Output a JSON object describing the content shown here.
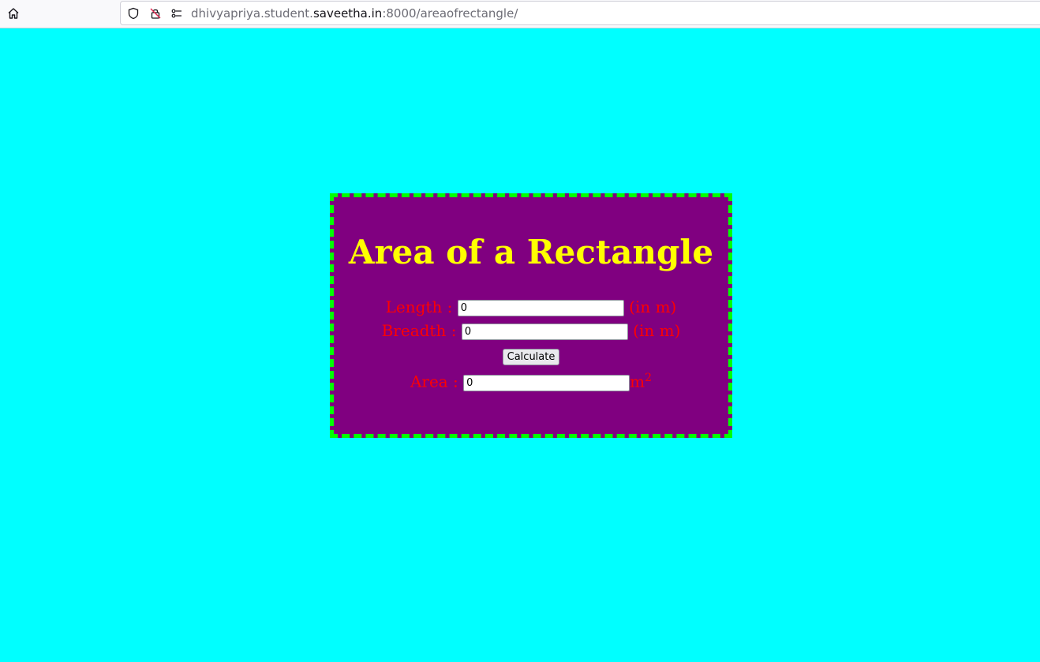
{
  "browser": {
    "url_prefix": "dhivyapriya.student.",
    "url_domain": "saveetha.in",
    "url_suffix": ":8000/areaofrectangle/",
    "icons": [
      "home-icon",
      "shield-icon",
      "tracking-off-icon",
      "permissions-icon"
    ]
  },
  "page": {
    "background_color": "#00ffff",
    "card": {
      "background_color": "#800080",
      "border_color": "#00ff00",
      "title": "Area of a Rectangle",
      "title_color": "#ffff00",
      "label_color": "#ff0000",
      "length_label": "Length :",
      "length_value": "0",
      "length_unit": "(in m)",
      "breadth_label": "Breadth :",
      "breadth_value": "0",
      "breadth_unit": "(in m)",
      "calculate_label": "Calculate",
      "area_label": "Area :",
      "area_value": "0",
      "area_unit": "m",
      "area_unit_power": "2"
    }
  }
}
